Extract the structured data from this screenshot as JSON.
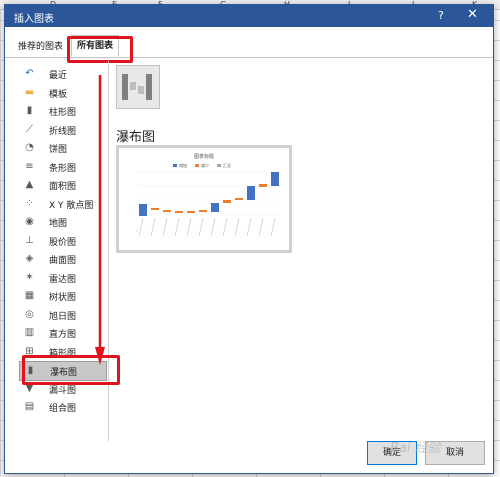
{
  "sheet": {
    "columns": [
      "D",
      "E",
      "F",
      "G",
      "H",
      "I",
      "J",
      "K"
    ]
  },
  "dialog": {
    "title": "插入图表",
    "help": "?",
    "close": "✕",
    "tabs": [
      {
        "label": "推荐的图表"
      },
      {
        "label": "所有图表"
      }
    ],
    "sidebar": [
      {
        "label": "最近",
        "icon": "undo-icon"
      },
      {
        "label": "模板",
        "icon": "folder-icon"
      },
      {
        "label": "柱形图",
        "icon": "column-chart-icon"
      },
      {
        "label": "折线图",
        "icon": "line-chart-icon"
      },
      {
        "label": "饼图",
        "icon": "pie-chart-icon"
      },
      {
        "label": "条形图",
        "icon": "bar-chart-icon"
      },
      {
        "label": "面积图",
        "icon": "area-chart-icon"
      },
      {
        "label": "X Y 散点图",
        "icon": "scatter-chart-icon"
      },
      {
        "label": "地图",
        "icon": "map-chart-icon"
      },
      {
        "label": "股价图",
        "icon": "stock-chart-icon"
      },
      {
        "label": "曲面图",
        "icon": "surface-chart-icon"
      },
      {
        "label": "雷达图",
        "icon": "radar-chart-icon"
      },
      {
        "label": "树状图",
        "icon": "treemap-chart-icon"
      },
      {
        "label": "旭日图",
        "icon": "sunburst-chart-icon"
      },
      {
        "label": "直方图",
        "icon": "histogram-chart-icon"
      },
      {
        "label": "箱形图",
        "icon": "box-whisker-chart-icon"
      },
      {
        "label": "瀑布图",
        "icon": "waterfall-chart-icon"
      },
      {
        "label": "漏斗图",
        "icon": "funnel-chart-icon"
      },
      {
        "label": "组合图",
        "icon": "combo-chart-icon"
      }
    ],
    "selected_index": 16,
    "content": {
      "chart_type_title": "瀑布图",
      "preview_title": "图表标题",
      "preview_legend": [
        "增加",
        "减少",
        "汇总"
      ]
    },
    "buttons": {
      "ok": "确定",
      "cancel": "取消"
    },
    "colors": {
      "title_bar": "#2b579a",
      "highlight": "#e0141e",
      "increase": "#4472c4",
      "decrease": "#ed7d31",
      "total": "#a5a5a5"
    }
  },
  "watermark": "Bai 经验"
}
